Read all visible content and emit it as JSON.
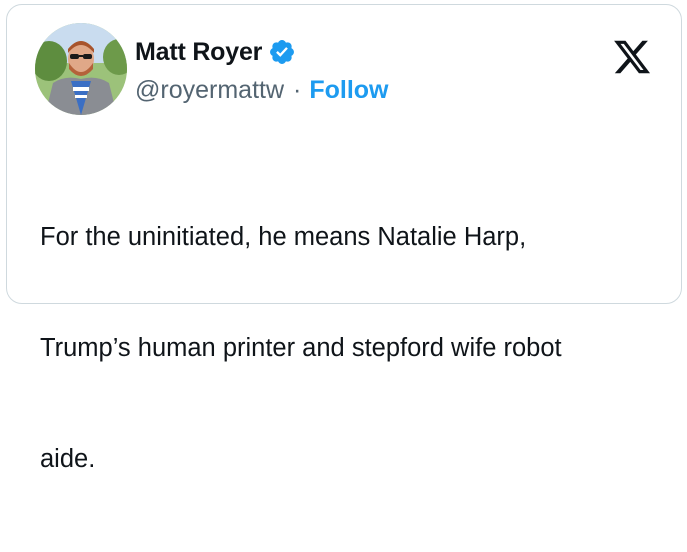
{
  "tweet": {
    "author": {
      "display_name": "Matt Royer",
      "handle": "@royermattw",
      "verified": true,
      "avatar_icon": "profile-photo"
    },
    "separator": "·",
    "follow_label": "Follow",
    "brand_icon": "x-logo",
    "text_lines": [
      "For the uninitiated, he means Natalie Harp,",
      "Trump’s human printer and stepford wife robot",
      "aide."
    ]
  },
  "colors": {
    "follow_blue": "#1d9bf0",
    "verified_blue": "#1d9bf0",
    "secondary_text": "#536471",
    "primary_text": "#0f1419",
    "border": "#cfd9de"
  }
}
